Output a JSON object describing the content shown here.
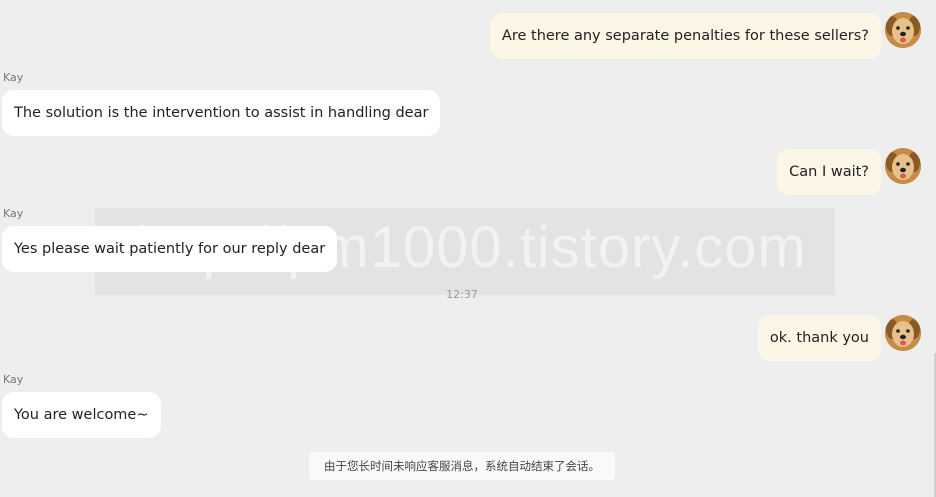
{
  "conversation": {
    "agent_name": "Kay",
    "timestamp": "12:37",
    "watermark_text": "http://pm1000.tistory.com",
    "messages": [
      {
        "direction": "outgoing",
        "text": "Are there any separate penalties for these sellers?"
      },
      {
        "direction": "incoming",
        "sender": "Kay",
        "text": "The solution is the intervention to assist in handling dear"
      },
      {
        "direction": "outgoing",
        "text": "Can I wait?"
      },
      {
        "direction": "incoming",
        "sender": "Kay",
        "text": "Yes please wait patiently for our reply dear"
      },
      {
        "direction": "outgoing",
        "text": "ok. thank you"
      },
      {
        "direction": "incoming",
        "sender": "Kay",
        "text": "You are welcome~"
      }
    ],
    "system_notice": "由于您长时间未响应客服消息，系统自动结束了会话。",
    "user_avatar_icon": "dog-avatar-icon"
  },
  "colors": {
    "background": "#eeeeee",
    "outgoing_bubble": "#fcf6e7",
    "incoming_bubble": "#ffffff",
    "text": "#222222"
  }
}
